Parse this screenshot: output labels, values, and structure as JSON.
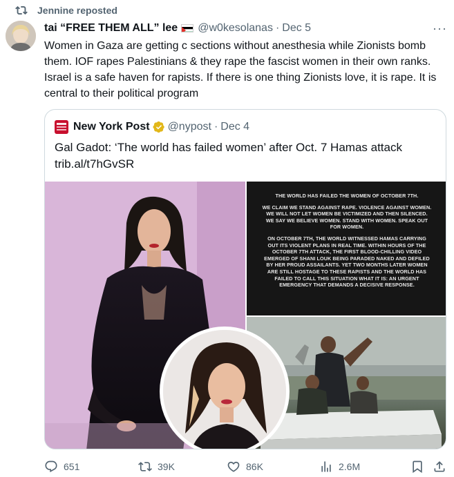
{
  "repost": {
    "icon": "repost-icon",
    "label": "Jennine reposted"
  },
  "tweet": {
    "author_name": "tai “FREE THEM ALL” lee",
    "handle": "@w0kesolanas",
    "separator": "·",
    "date": "Dec 5",
    "more": "···",
    "text": "Women in Gaza are getting c sections without anesthesia while Zionists bomb them. IOF rapes Palestinians & they rape the fascist women in their own ranks. Israel is a safe haven for rapists. If there is one thing Zionists love, it is rape. It is central to their political program"
  },
  "quote": {
    "logo_text": "NEW YORK POST",
    "name": "New York Post",
    "handle": "@nypost",
    "separator": "·",
    "date": "Dec 4",
    "text": "Gal Gadot: ‘The world has failed women’ after Oct. 7 Hamas attack trib.al/t7hGvSR",
    "statement": {
      "p1": "THE WORLD HAS FAILED THE WOMEN OF OCTOBER 7TH.",
      "p2": "WE CLAIM WE STAND AGAINST RAPE. VIOLENCE AGAINST WOMEN. WE WILL NOT LET WOMEN BE VICTIMIZED AND THEN SILENCED. WE SAY WE BELIEVE WOMEN. STAND WITH WOMEN. SPEAK OUT FOR WOMEN.",
      "p3": "ON OCTOBER 7TH, THE WORLD WITNESSED HAMAS CARRYING OUT ITS VIOLENT PLANS IN REAL TIME. WITHIN HOURS OF THE OCTOBER 7TH ATTACK, THE FIRST BLOOD-CHILLING VIDEO EMERGED OF SHANI LOUK BEING PARADED NAKED AND DEFILED BY HER PROUD ASSAILANTS. YET TWO MONTHS LATER WOMEN ARE STILL HOSTAGE TO THESE RAPISTS AND THE WORLD HAS FAILED TO CALL THIS SITUATION WHAT IT IS: AN URGENT EMERGENCY THAT DEMANDS A DECISIVE RESPONSE."
    }
  },
  "actions": {
    "replies": "651",
    "reposts": "39K",
    "likes": "86K",
    "views": "2.6M"
  },
  "colors": {
    "text_secondary": "#536471",
    "border": "#cfd9de",
    "nypost_red": "#c8102e",
    "verified_gold": "#e2b719"
  }
}
